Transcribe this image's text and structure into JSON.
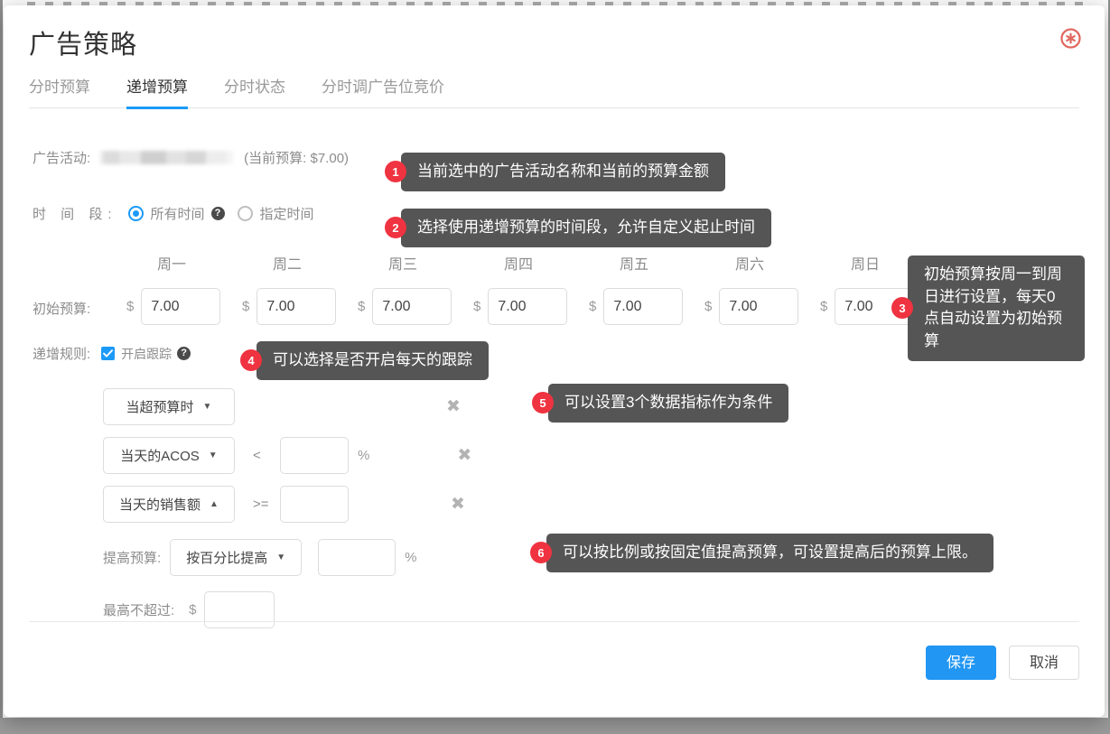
{
  "modal": {
    "title": "广告策略",
    "close_icon": "close-circle-icon"
  },
  "tabs": [
    {
      "label": "分时预算",
      "active": false
    },
    {
      "label": "递增预算",
      "active": true
    },
    {
      "label": "分时状态",
      "active": false
    },
    {
      "label": "分时调广告位竞价",
      "active": false
    }
  ],
  "campaign": {
    "label": "广告活动:",
    "name_redacted": "",
    "budget_note": "(当前预算: $7.00)"
  },
  "time_period": {
    "label": "时 间 段:",
    "options": [
      {
        "label": "所有时间",
        "checked": true,
        "has_help": true
      },
      {
        "label": "指定时间",
        "checked": false,
        "has_help": false
      }
    ]
  },
  "initial_budget": {
    "label": "初始预算:",
    "currency": "$",
    "days": [
      {
        "name": "周一",
        "value": "7.00"
      },
      {
        "name": "周二",
        "value": "7.00"
      },
      {
        "name": "周三",
        "value": "7.00"
      },
      {
        "name": "周四",
        "value": "7.00"
      },
      {
        "name": "周五",
        "value": "7.00"
      },
      {
        "name": "周六",
        "value": "7.00"
      },
      {
        "name": "周日",
        "value": "7.00"
      }
    ]
  },
  "rules": {
    "label": "递增规则:",
    "tracking_label": "开启跟踪",
    "tracking_checked": true,
    "conditions": [
      {
        "metric": "当超预算时",
        "caret": "▼",
        "operator": "",
        "value": "",
        "unit": "",
        "delete_icon": "close-x-icon"
      },
      {
        "metric": "当天的ACOS",
        "caret": "▼",
        "operator": "<",
        "value": "",
        "unit": "%",
        "delete_icon": "close-x-icon"
      },
      {
        "metric": "当天的销售额",
        "caret": "▲",
        "operator": ">=",
        "value": "",
        "unit": "",
        "delete_icon": "close-x-icon"
      }
    ],
    "raise": {
      "label": "提高预算:",
      "mode": "按百分比提高",
      "caret": "▼",
      "value": "",
      "unit": "%"
    },
    "cap": {
      "label": "最高不超过:",
      "currency": "$",
      "value": ""
    }
  },
  "tooltips": [
    {
      "num": "1",
      "text": "当前选中的广告活动名称和当前的预算金额"
    },
    {
      "num": "2",
      "text": "选择使用递增预算的时间段，允许自定义起止时间"
    },
    {
      "num": "3",
      "text": "初始预算按周一到周日进行设置，每天0点自动设置为初始预算"
    },
    {
      "num": "4",
      "text": "可以选择是否开启每天的跟踪"
    },
    {
      "num": "5",
      "text": "可以设置3个数据指标作为条件"
    },
    {
      "num": "6",
      "text": "可以按比例或按固定值提高预算，可设置提高后的预算上限。"
    }
  ],
  "footer": {
    "save_label": "保存",
    "cancel_label": "取消"
  },
  "colors": {
    "accent": "#1b9af7",
    "primary_button": "#2196f3",
    "tooltip_bg": "#555555",
    "tooltip_badge": "#ef3340",
    "close_icon": "#e0685e"
  }
}
